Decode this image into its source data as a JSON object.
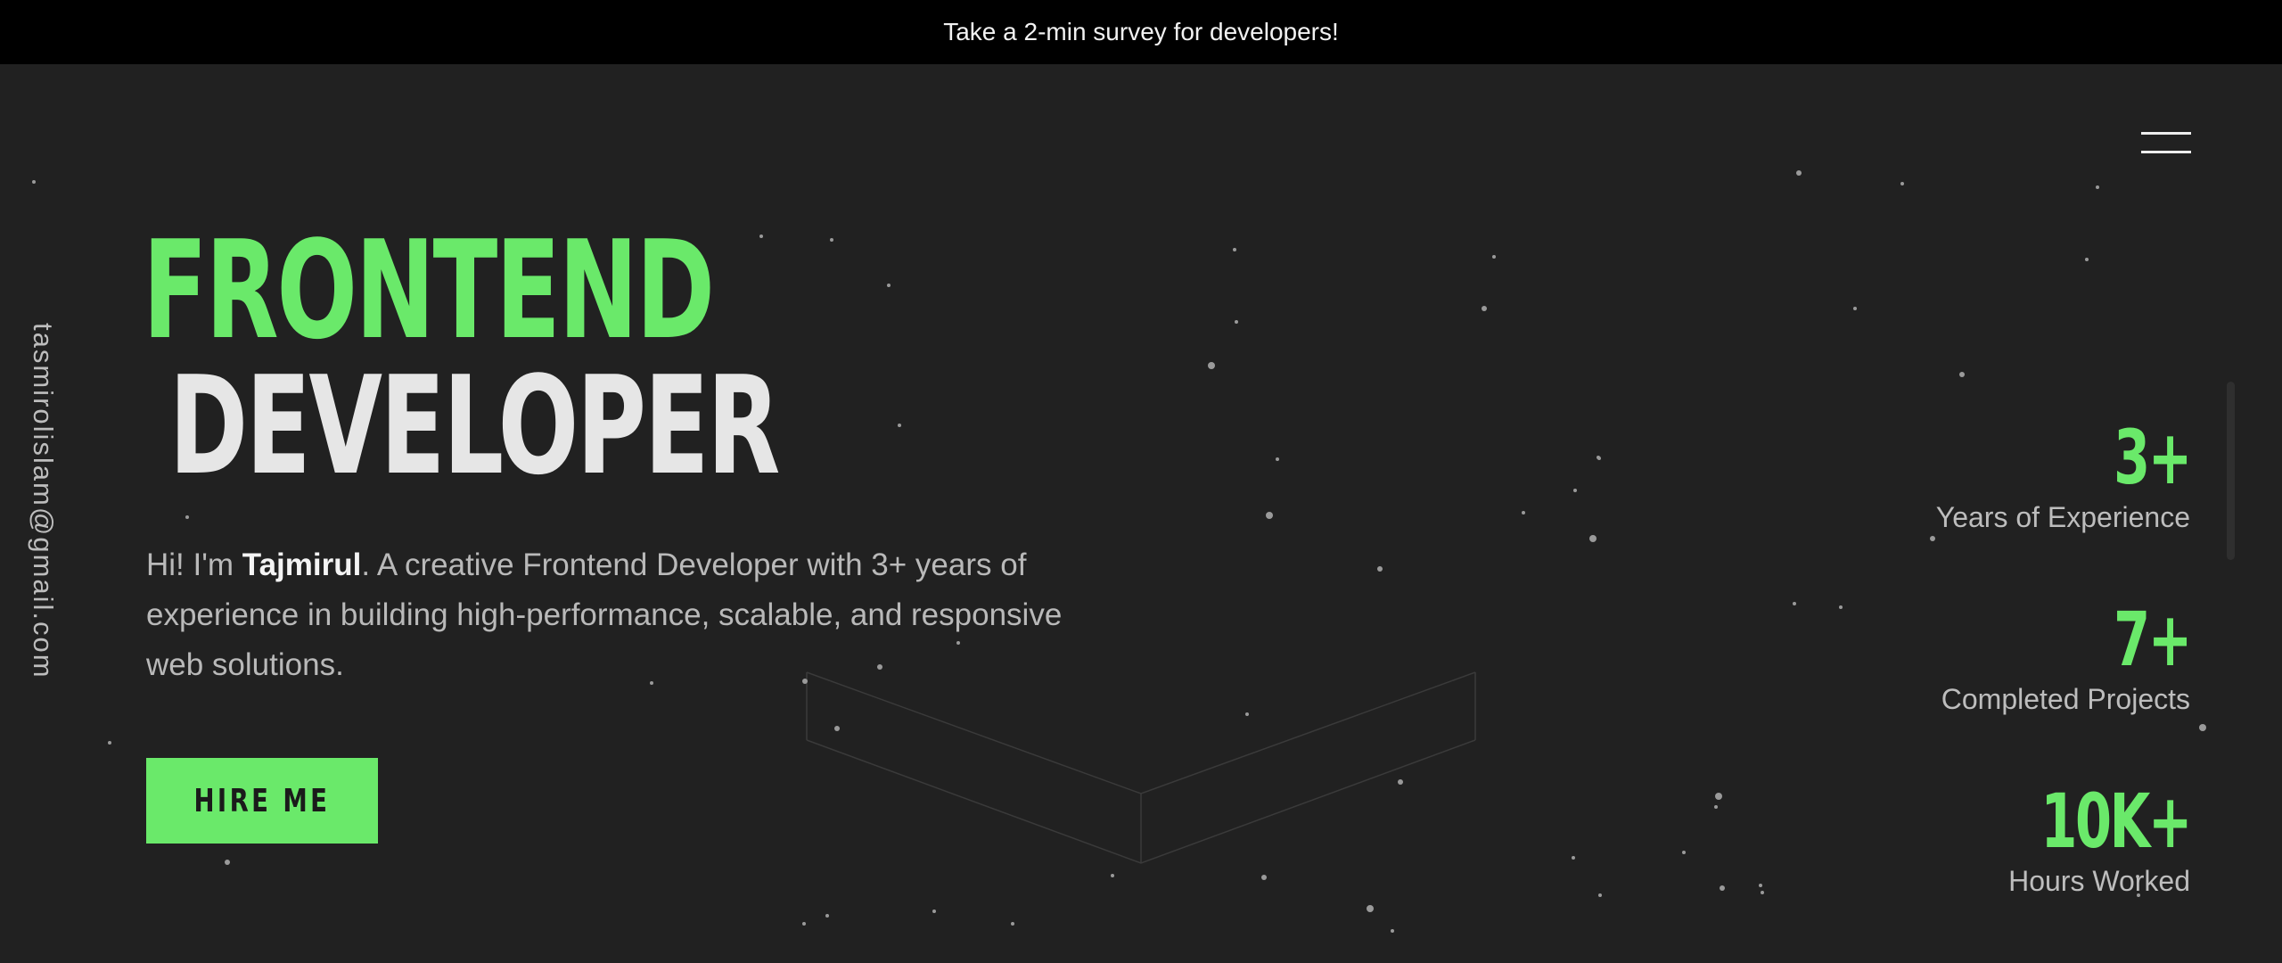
{
  "announcement": {
    "text": "Take a 2-min survey for developers!"
  },
  "sidebar": {
    "email": "tasmirolislam@gmail.com"
  },
  "hero": {
    "title_line1": "FRONTEND",
    "title_line2": "DEVELOPER",
    "intro_before": "Hi! I'm ",
    "intro_name": "Tajmirul",
    "intro_after": ". A creative Frontend Developer with 3+ years of experience in building high-performance, scalable, and responsive web solutions.",
    "cta_label": "HIRE ME"
  },
  "stats": [
    {
      "value": "3+",
      "label": "Years of Experience"
    },
    {
      "value": "7+",
      "label": "Completed Projects"
    },
    {
      "value": "10K+",
      "label": "Hours Worked"
    }
  ],
  "icons": {
    "menu": "hamburger-menu-icon"
  },
  "colors": {
    "background": "#212121",
    "accent": "#6ae96a",
    "announcement_bg": "#000000"
  }
}
